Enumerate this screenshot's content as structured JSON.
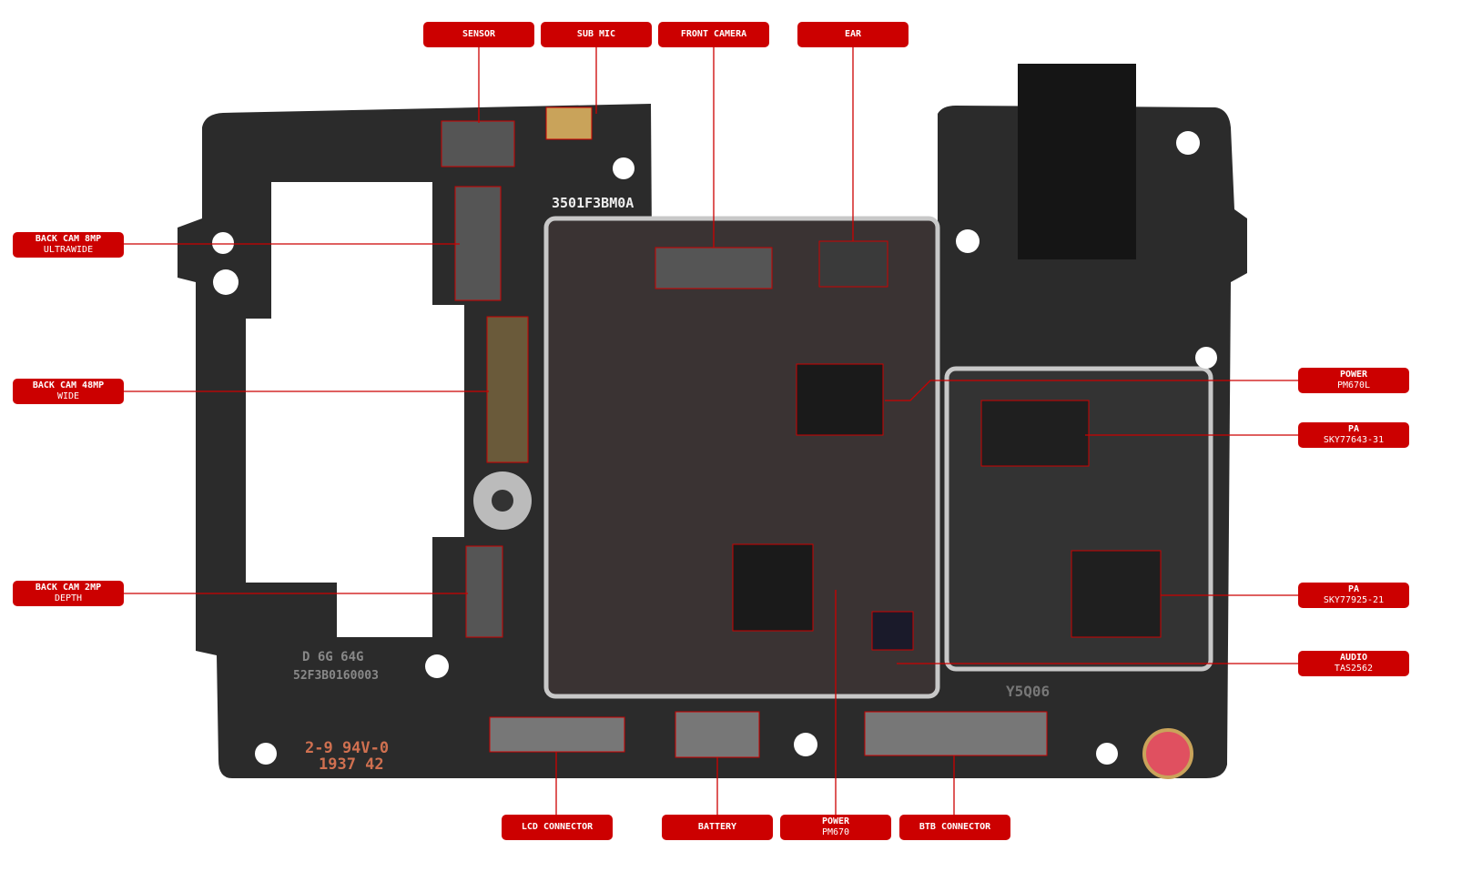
{
  "colors": {
    "label_bg": "#cc0000",
    "label_text": "#ffffff",
    "leader_line": "#cc0000",
    "board": "#2b2b2b",
    "shield": "#c8c8c8"
  },
  "labels": {
    "sensor": {
      "title": "SENSOR"
    },
    "sub_mic": {
      "title": "SUB MIC"
    },
    "front_camera": {
      "title": "FRONT CAMERA"
    },
    "ear": {
      "title": "EAR"
    },
    "back_cam_8mp": {
      "title": "BACK CAM 8MP",
      "subtitle": "ULTRAWIDE"
    },
    "back_cam_48mp": {
      "title": "BACK CAM 48MP",
      "subtitle": "WIDE"
    },
    "back_cam_2mp": {
      "title": "BACK CAM 2MP",
      "subtitle": "DEPTH"
    },
    "power_pm670l": {
      "title": "POWER",
      "subtitle": "PM670L"
    },
    "pa_sky77643": {
      "title": "PA",
      "subtitle": "SKY77643-31"
    },
    "pa_sky77925": {
      "title": "PA",
      "subtitle": "SKY77925-21"
    },
    "audio": {
      "title": "AUDIO",
      "subtitle": "TAS2562"
    },
    "lcd_connector": {
      "title": "LCD CONNECTOR"
    },
    "battery": {
      "title": "BATTERY"
    },
    "power_pm670": {
      "title": "POWER",
      "subtitle": "PM670"
    },
    "btb_connector": {
      "title": "BTB CONNECTOR"
    }
  },
  "board_markings": {
    "part_no": "3501F3BM0A",
    "variant": "D 6G 64G",
    "serial": "52F3B0160003",
    "code": "Y5Q06",
    "rating": "2-9 94V-0",
    "date": "1937 42"
  }
}
